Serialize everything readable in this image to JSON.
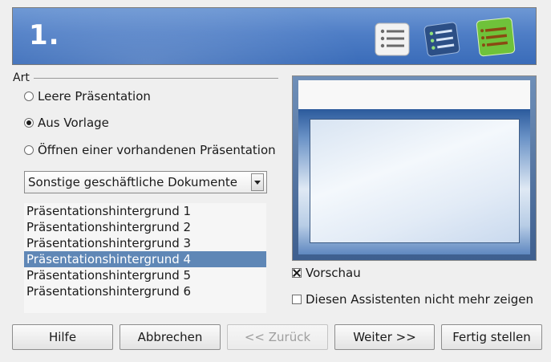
{
  "header": {
    "step_title": "1.",
    "icons": [
      "list-icon-gray",
      "list-icon-blue",
      "list-icon-green"
    ]
  },
  "type_group": {
    "label": "Art",
    "options": [
      {
        "label": "Leere Präsentation",
        "selected": false
      },
      {
        "label": "Aus Vorlage",
        "selected": true
      },
      {
        "label": "Öffnen einer vorhandenen Präsentation",
        "selected": false
      }
    ]
  },
  "template_category": {
    "value": "Sonstige geschäftliche Dokumente"
  },
  "templates": {
    "items": [
      "Präsentationshintergrund 1",
      "Präsentationshintergrund 2",
      "Präsentationshintergrund 3",
      "Präsentationshintergrund 4",
      "Präsentationshintergrund 5",
      "Präsentationshintergrund 6"
    ],
    "selected_index": 3
  },
  "preview": {
    "checkbox_label": "Vorschau",
    "checked": true
  },
  "dont_show": {
    "label": "Diesen Assistenten nicht mehr zeigen",
    "checked": false
  },
  "buttons": {
    "help": "Hilfe",
    "cancel": "Abbrechen",
    "back": "<< Zurück",
    "next": "Weiter >>",
    "finish": "Fertig stellen"
  },
  "colors": {
    "banner": "#4f7ec6",
    "selection": "#5f87b6"
  }
}
